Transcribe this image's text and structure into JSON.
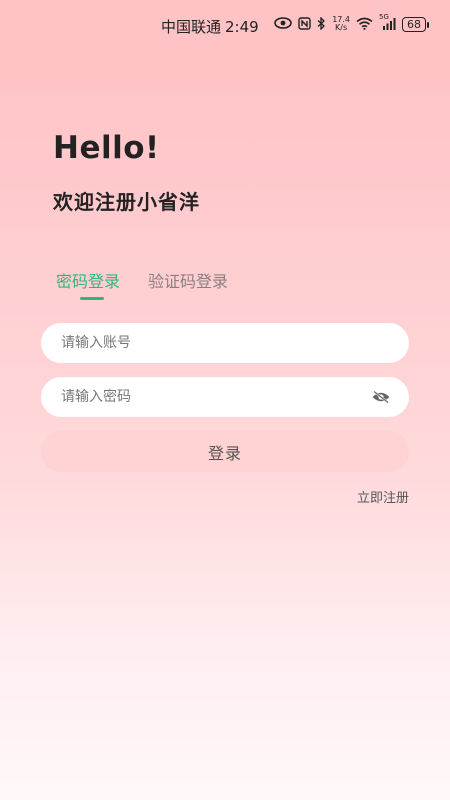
{
  "status_bar": {
    "carrier": "中国联通",
    "time": "2:49",
    "net_speed_value": "17.4",
    "net_speed_unit": "K/s",
    "network_type": "5G",
    "battery": "68",
    "icons": [
      "eye-icon",
      "nfc-icon",
      "bluetooth-icon",
      "wifi-icon",
      "signal-icon",
      "battery-icon"
    ]
  },
  "header": {
    "greeting": "Hello!",
    "subtitle": "欢迎注册小省洋"
  },
  "tabs": [
    {
      "label": "密码登录",
      "active": true
    },
    {
      "label": "验证码登录",
      "active": false
    }
  ],
  "form": {
    "account_placeholder": "请输入账号",
    "account_value": "",
    "password_placeholder": "请输入密码",
    "password_value": ""
  },
  "actions": {
    "login_label": "登录",
    "register_label": "立即注册"
  },
  "colors": {
    "accent": "#2fb67c",
    "background_top": "#ffc3c6",
    "button_bg": "#ffd2d3"
  }
}
